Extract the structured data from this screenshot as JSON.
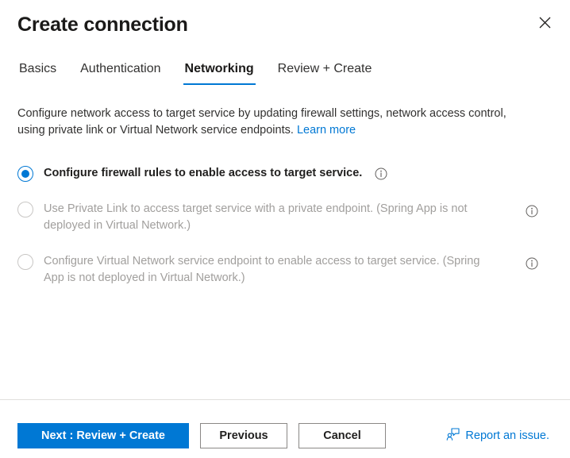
{
  "dialog": {
    "title": "Create connection",
    "close_label": "Close"
  },
  "tabs": [
    {
      "label": "Basics",
      "active": false
    },
    {
      "label": "Authentication",
      "active": false
    },
    {
      "label": "Networking",
      "active": true
    },
    {
      "label": "Review + Create",
      "active": false
    }
  ],
  "intro": {
    "text": "Configure network access to target service by updating firewall settings, network access control, using private link or Virtual Network service endpoints.",
    "link_label": "Learn more"
  },
  "options": [
    {
      "label": "Configure firewall rules to enable access to target service.",
      "selected": true,
      "disabled": false,
      "info_position": "inline"
    },
    {
      "label": "Use Private Link to access target service with a private endpoint. (Spring App is not deployed in Virtual Network.)",
      "selected": false,
      "disabled": true,
      "info_position": "right"
    },
    {
      "label": "Configure Virtual Network service endpoint to enable access to target service. (Spring App is not deployed in Virtual Network.)",
      "selected": false,
      "disabled": true,
      "info_position": "right"
    }
  ],
  "footer": {
    "next_label": "Next : Review + Create",
    "previous_label": "Previous",
    "cancel_label": "Cancel",
    "report_label": "Report an issue."
  },
  "colors": {
    "accent": "#0078d4",
    "link": "#0078d4",
    "text": "#323130",
    "disabled_text": "#a19f9d",
    "border": "#e1dfdd"
  }
}
